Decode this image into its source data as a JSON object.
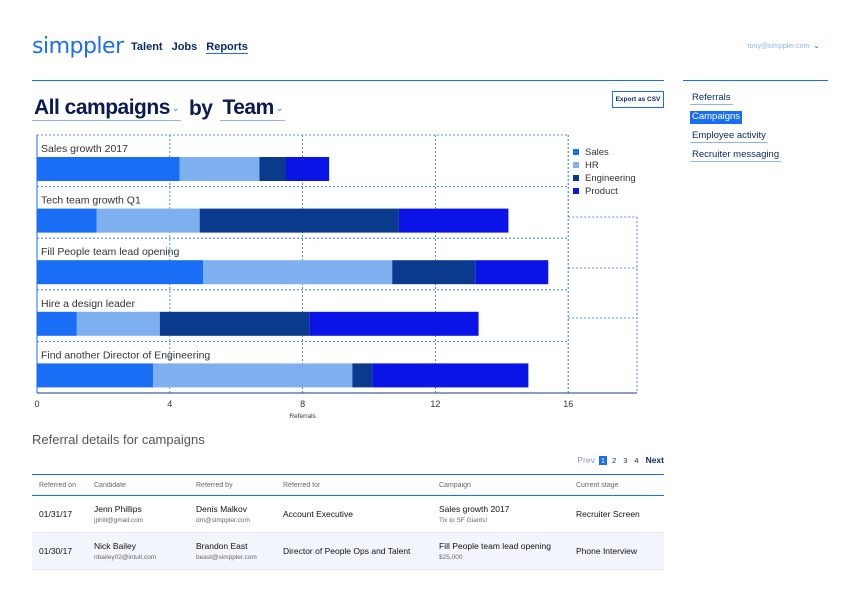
{
  "app": {
    "logo": "simppler"
  },
  "nav": {
    "items": [
      "Talent",
      "Jobs",
      "Reports"
    ],
    "active": "Reports"
  },
  "user": {
    "email": "tony@simppler.com"
  },
  "heading": {
    "selector1": "All campaigns",
    "connector": "by",
    "selector2": "Team"
  },
  "export_label": "Export as CSV",
  "sidebar": {
    "items": [
      {
        "label": "Referrals",
        "active": false
      },
      {
        "label": "Campaigns",
        "active": true
      },
      {
        "label": "Employee activity",
        "active": false
      },
      {
        "label": "Recruiter messaging",
        "active": false
      }
    ]
  },
  "chart_data": {
    "type": "bar",
    "orientation": "horizontal",
    "stacked": true,
    "categories": [
      "Sales growth 2017",
      "Tech team growth Q1",
      "Fill People team lead opening",
      "Hire a design leader",
      "Find another Director of Engineering"
    ],
    "series": [
      {
        "name": "Sales",
        "color": "#1a6ef5",
        "values": [
          4.3,
          1.8,
          5.0,
          1.2,
          3.5
        ]
      },
      {
        "name": "HR",
        "color": "#7eb0f0",
        "values": [
          2.4,
          3.1,
          5.7,
          2.5,
          6.0
        ]
      },
      {
        "name": "Engineering",
        "color": "#0a3a8c",
        "values": [
          0.8,
          6.0,
          2.5,
          4.5,
          0.6
        ]
      },
      {
        "name": "Product",
        "color": "#0a14e6",
        "values": [
          1.3,
          3.3,
          2.2,
          5.1,
          4.7
        ]
      }
    ],
    "xlabel": "Referrals",
    "ticks": [
      0,
      4,
      8,
      12,
      16
    ],
    "xlim": [
      0,
      16
    ],
    "legend": "top-right",
    "grid": true
  },
  "details": {
    "title": "Referral details for campaigns",
    "pager": {
      "prev": "Prev",
      "pages": [
        "1",
        "2",
        "3",
        "4"
      ],
      "current": "1",
      "next": "Next"
    },
    "columns": [
      "Referred on",
      "Candidate",
      "Referred by",
      "Referred for",
      "Campaign",
      "Current stage"
    ],
    "rows": [
      {
        "date": "01/31/17",
        "candidate": "Jenn Phillips",
        "candidate_email": "jphill@gmail.com",
        "referrer": "Denis Malkov",
        "referrer_email": "dm@simppler.com",
        "role": "Account Executive",
        "campaign": "Sales growth 2017",
        "campaign_note": "Tix to SF Giants!",
        "stage": "Recruiter Screen"
      },
      {
        "date": "01/30/17",
        "candidate": "Nick Bailey",
        "candidate_email": "nbailey02@intuit.com",
        "referrer": "Brandon East",
        "referrer_email": "beast@simppler.com",
        "role": "Director of People Ops and Talent",
        "campaign": "Fill People team lead opening",
        "campaign_note": "$25,000",
        "stage": "Phone Interview"
      }
    ]
  }
}
